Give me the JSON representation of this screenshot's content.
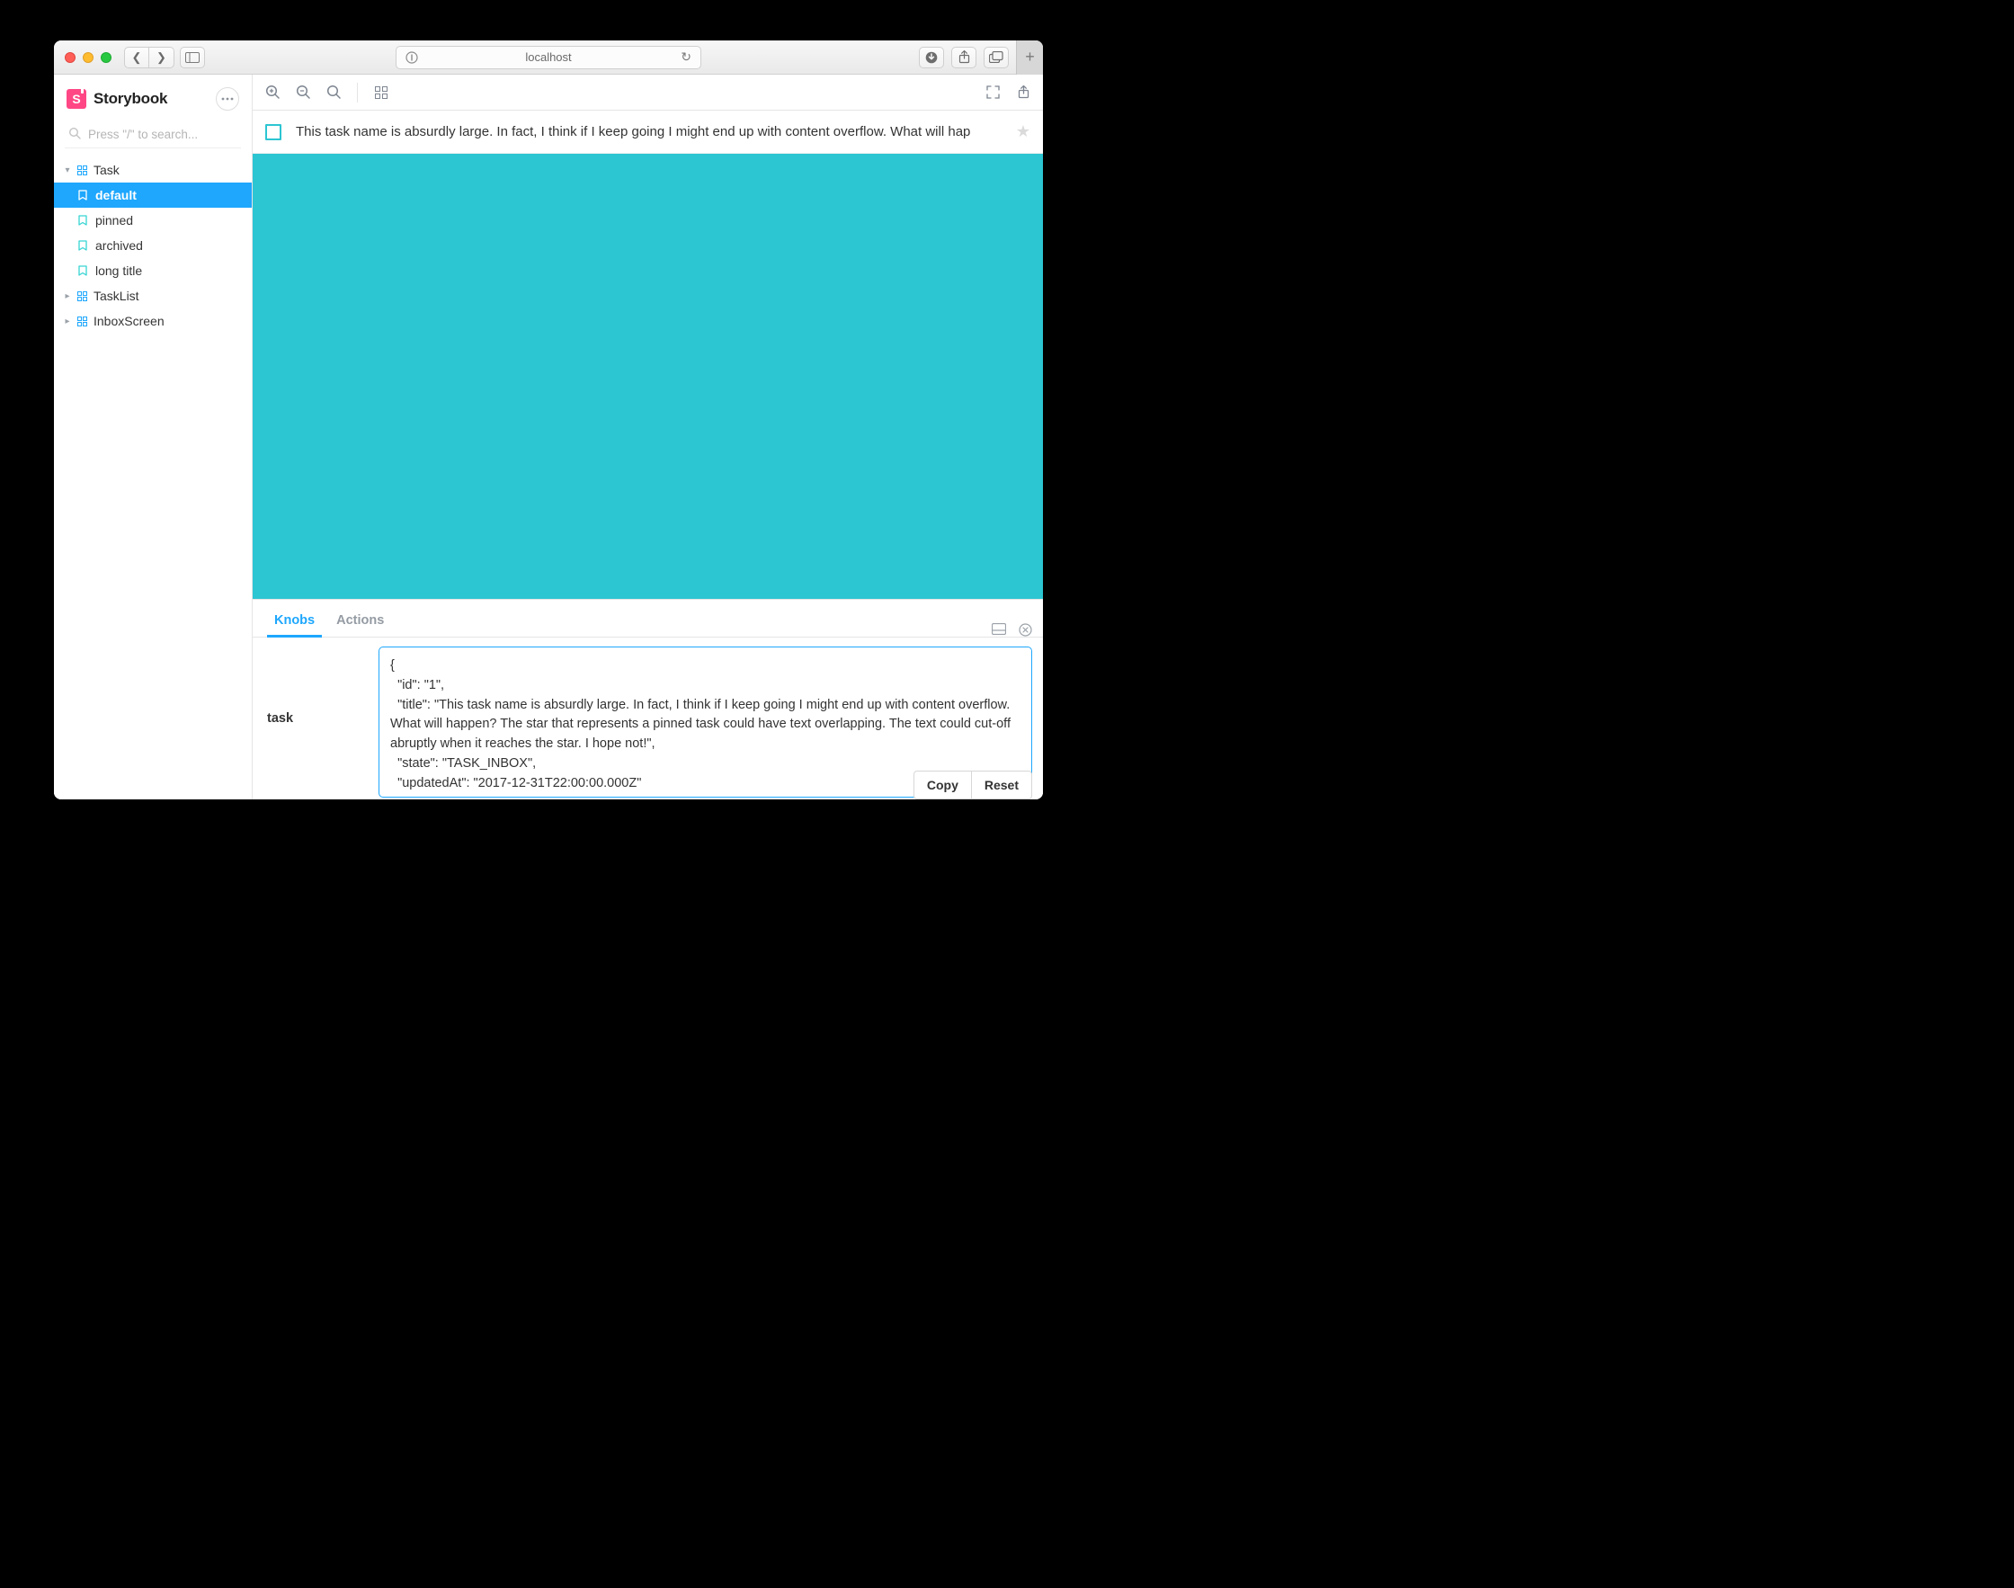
{
  "browser": {
    "url": "localhost"
  },
  "sidebar": {
    "appName": "Storybook",
    "logoLetter": "S",
    "searchPlaceholder": "Press \"/\" to search...",
    "nodes": {
      "task": "Task",
      "task_stories": {
        "default": "default",
        "pinned": "pinned",
        "archived": "archived",
        "long_title": "long title"
      },
      "tasklist": "TaskList",
      "inboxscreen": "InboxScreen"
    }
  },
  "story": {
    "task_title": "This task name is absurdly large. In fact, I think if I keep going I might end up with content overflow. What will hap"
  },
  "addons": {
    "tabs": {
      "knobs": "Knobs",
      "actions": "Actions"
    },
    "knob_name": "task",
    "knob_value": "{\n  \"id\": \"1\",\n  \"title\": \"This task name is absurdly large. In fact, I think if I keep going I might end up with content overflow. What will happen? The star that represents a pinned task could have text overlapping. The text could cut-off abruptly when it reaches the star. I hope not!\",\n  \"state\": \"TASK_INBOX\",\n  \"updatedAt\": \"2017-12-31T22:00:00.000Z\"",
    "buttons": {
      "copy": "Copy",
      "reset": "Reset"
    }
  }
}
